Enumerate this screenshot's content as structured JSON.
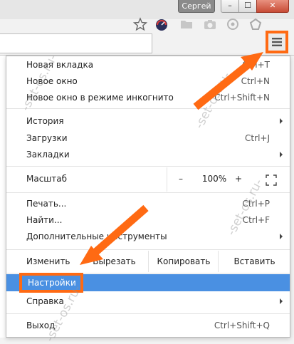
{
  "window": {
    "profile_label": "Сергей",
    "minimize_glyph": "–",
    "maximize_glyph": "☐",
    "close_glyph": "✕"
  },
  "toolbar": {
    "icons": [
      "star-icon",
      "speedometer-icon",
      "folder-icon",
      "camera-icon",
      "extension-icon",
      "extension-icon",
      "menu-icon"
    ]
  },
  "menu": {
    "items": [
      {
        "label": "Новая вкладка",
        "shortcut": "Ctrl+T"
      },
      {
        "label": "Новое окно",
        "shortcut": "Ctrl+N"
      },
      {
        "label": "Новое окно в режиме инкогнито",
        "shortcut": "Ctrl+Shift+N"
      },
      {
        "label": "История",
        "shortcut": ""
      },
      {
        "label": "Загрузки",
        "shortcut": "Ctrl+J"
      },
      {
        "label": "Закладки",
        "shortcut": ""
      },
      {
        "label": "Печать...",
        "shortcut": "Ctrl+P"
      },
      {
        "label": "Найти...",
        "shortcut": "Ctrl+F"
      },
      {
        "label": "Дополнительные инструменты",
        "shortcut": ""
      },
      {
        "label": "Справка",
        "shortcut": ""
      },
      {
        "label": "Выход",
        "shortcut": "Ctrl+Shift+Q"
      }
    ],
    "zoom": {
      "label": "Масштаб",
      "minus": "–",
      "value": "100%",
      "plus": "+"
    },
    "edit": {
      "label": "Изменить",
      "cut": "Вырезать",
      "copy": "Копировать",
      "paste": "Вставить"
    },
    "settings_label": "Настройки"
  },
  "watermarks": [
    "-set-os.ru-",
    "-set-os.ru-",
    "-set-os.ru-",
    "-set-os.ru-"
  ],
  "colors": {
    "highlight": "#4a90e2",
    "callout": "#ff6a13"
  }
}
